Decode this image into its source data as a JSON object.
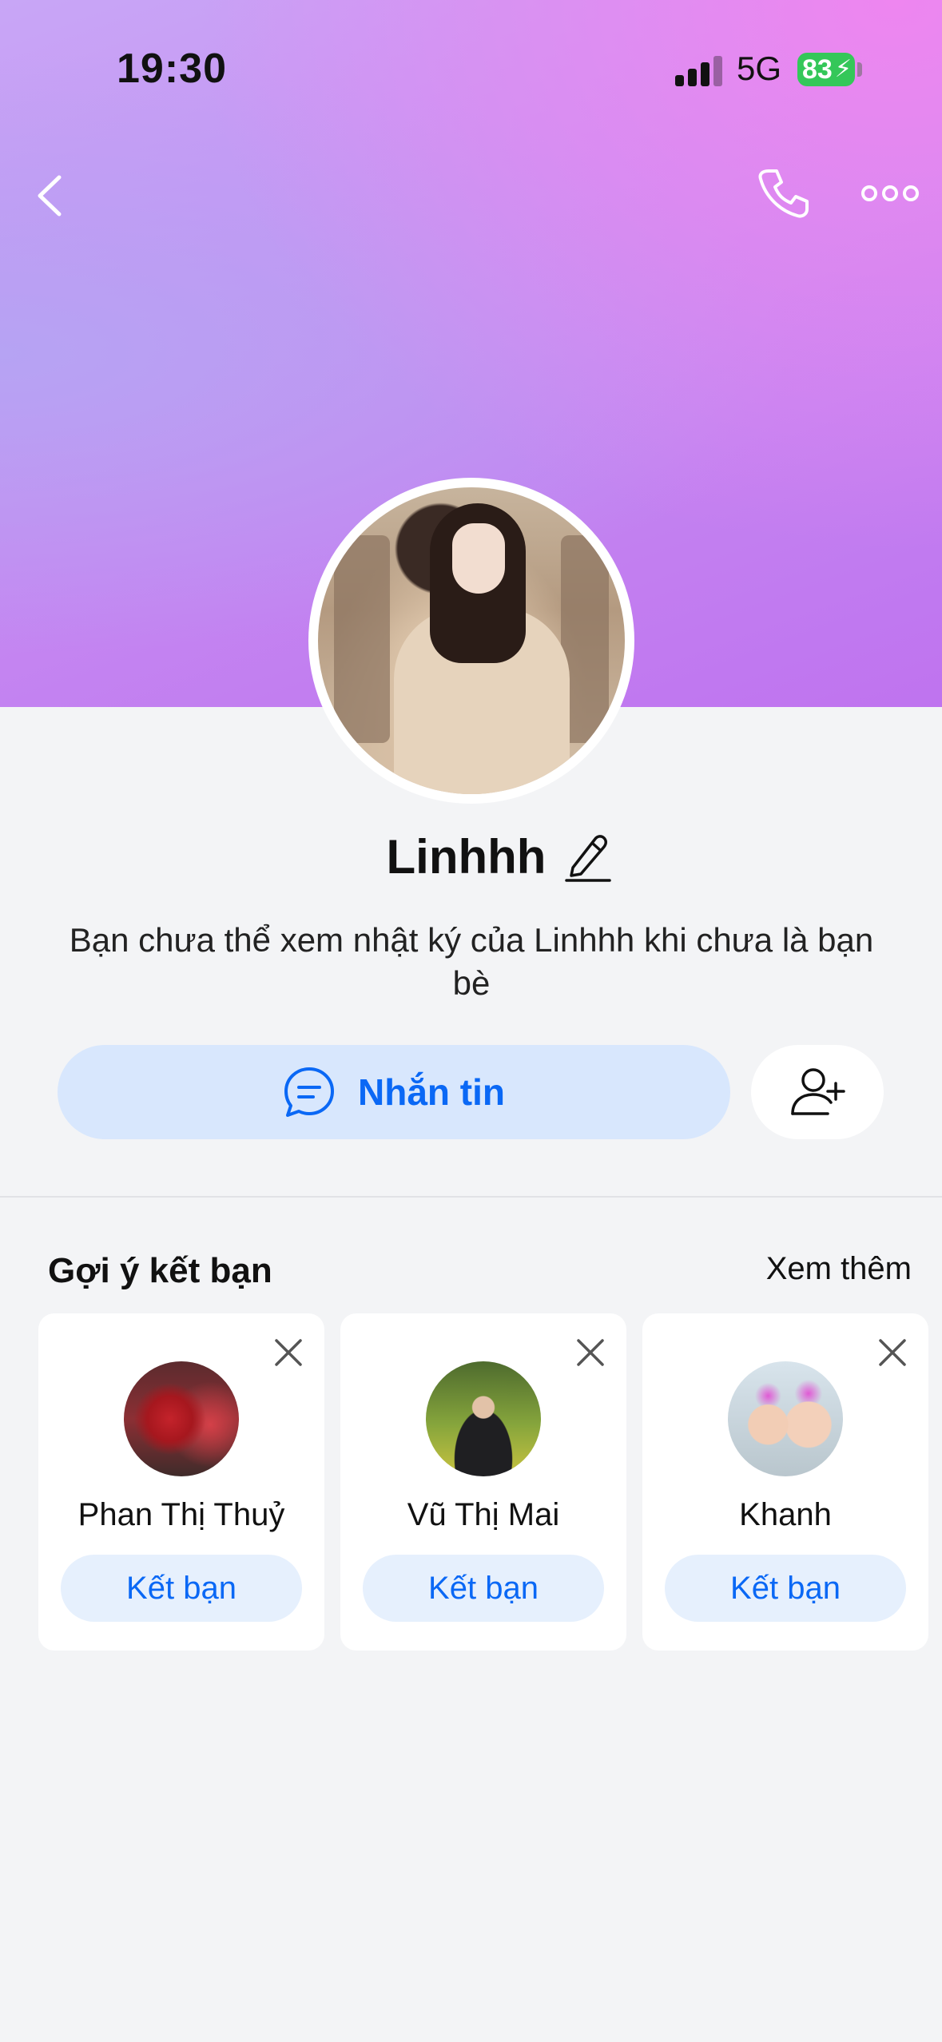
{
  "status_bar": {
    "time": "19:30",
    "network": "5G",
    "battery": "83"
  },
  "header": {
    "back_icon": "chevron-left-icon",
    "call_icon": "phone-icon",
    "more_icon": "more-dots-icon"
  },
  "profile": {
    "name": "Linhhh",
    "notice": "Bạn chưa thể xem nhật ký của Linhhh khi chưa là bạn bè",
    "message_button": "Nhắn tin"
  },
  "suggestions": {
    "title": "Gợi ý kết bạn",
    "see_more": "Xem thêm",
    "items": [
      {
        "name": "Phan Thị Thuỷ",
        "button": "Kết bạn"
      },
      {
        "name": "Vũ Thị Mai",
        "button": "Kết bạn"
      },
      {
        "name": "Khanh",
        "button": "Kết bạn"
      }
    ]
  },
  "colors": {
    "accent": "#0a68f5",
    "button_bg": "#d8e7fd",
    "battery": "#34c759"
  }
}
